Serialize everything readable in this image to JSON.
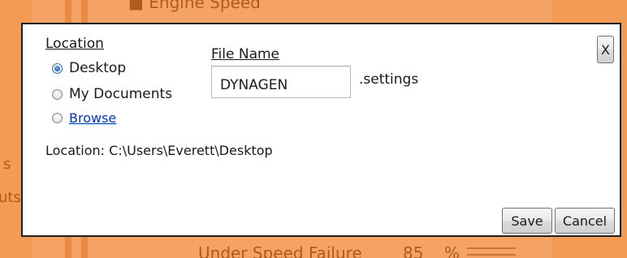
{
  "background": {
    "title_top": "Engine Speed",
    "bottom_label": "Under Speed Failure",
    "bottom_value": "85",
    "bottom_unit": "%",
    "left_fragment_1": "s",
    "left_fragment_2": "uts"
  },
  "dialog": {
    "location_label": "Location",
    "options": [
      {
        "label": "Desktop",
        "selected": true
      },
      {
        "label": "My Documents",
        "selected": false
      },
      {
        "label": "Browse",
        "selected": false
      }
    ],
    "file_name_label": "File Name",
    "file_name_value": "DYNAGEN",
    "extension": ".settings",
    "location_path": "Location: C:\\Users\\Everett\\Desktop",
    "close_label": "X",
    "save_label": "Save",
    "cancel_label": "Cancel"
  },
  "colors": {
    "background": "#f39a55",
    "dialog_bg": "#ffffff",
    "link": "#0033cc",
    "radio_selected": "#2a66b8"
  }
}
